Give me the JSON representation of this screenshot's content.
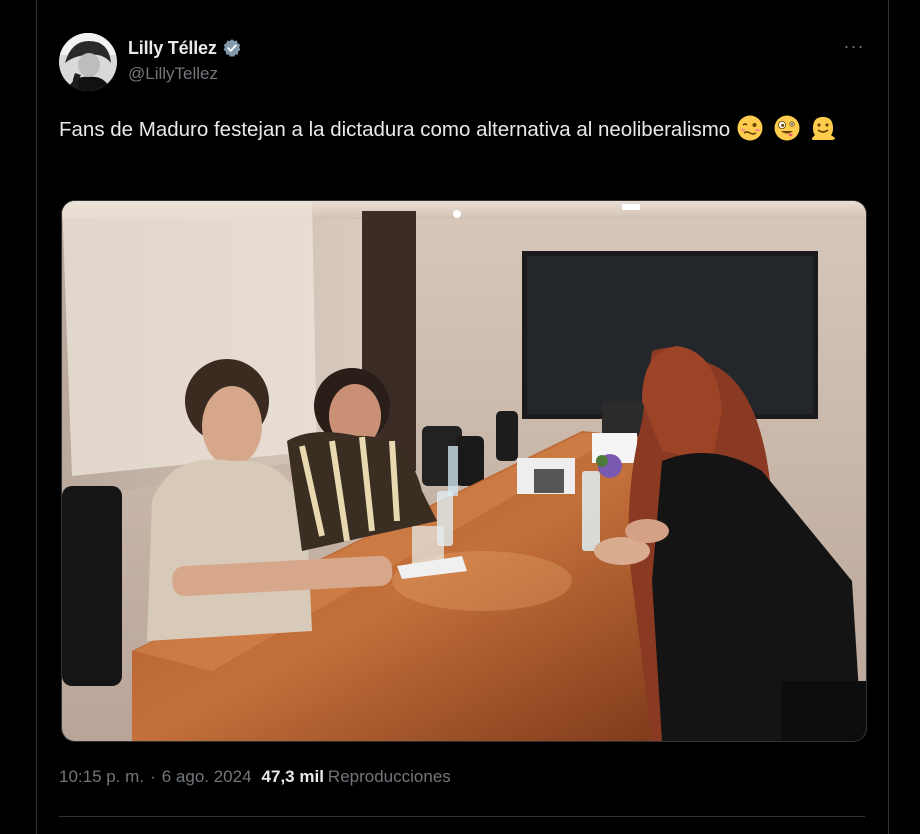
{
  "tweet": {
    "author_name": "Lilly Téllez",
    "author_handle": "@LillyTellez",
    "more_label": "···",
    "text": "Fans de Maduro festejan a la dictadura como alternativa al neoliberalismo",
    "emojis": [
      "woozy-face",
      "zany-face",
      "melting-face"
    ],
    "time": "10:15 p. m.",
    "separator": "·",
    "date": "6 ago. 2024",
    "views_count": "47,3 mil",
    "views_label": "Reproducciones"
  },
  "colors": {
    "background": "#000000",
    "text_primary": "#e7e9ea",
    "text_secondary": "#71767b",
    "verified_badge": "#829aab",
    "border": "#2f3336"
  }
}
